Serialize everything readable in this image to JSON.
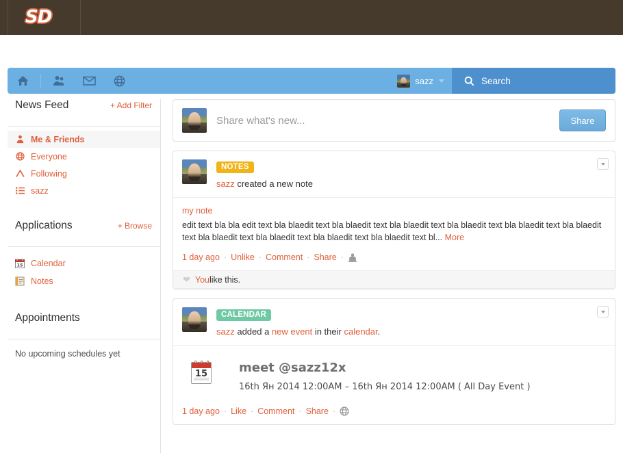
{
  "brand": {
    "logo_text": "SD"
  },
  "nav": {
    "icons": [
      {
        "name": "home-icon",
        "label": "Home"
      },
      {
        "name": "friends-icon",
        "label": "Friends"
      },
      {
        "name": "mail-icon",
        "label": "Messages"
      },
      {
        "name": "globe-icon",
        "label": "Explore"
      }
    ],
    "user": {
      "name": "sazz"
    },
    "search": {
      "placeholder": "Search"
    }
  },
  "sidebar": {
    "news_feed": {
      "title": "News Feed",
      "action": "+ Add Filter",
      "items": [
        {
          "label": "Me & Friends",
          "icon": "person-icon",
          "active": true
        },
        {
          "label": "Everyone",
          "icon": "globe-icon",
          "active": false
        },
        {
          "label": "Following",
          "icon": "following-icon",
          "active": false
        },
        {
          "label": "sazz",
          "icon": "list-icon",
          "active": false
        }
      ]
    },
    "applications": {
      "title": "Applications",
      "action": "+ Browse",
      "items": [
        {
          "label": "Calendar",
          "icon": "calendar-icon"
        },
        {
          "label": "Notes",
          "icon": "notes-icon"
        }
      ]
    },
    "appointments": {
      "title": "Appointments",
      "empty_text": "No upcoming schedules yet"
    }
  },
  "share_box": {
    "placeholder": "Share what's new...",
    "button_label": "Share"
  },
  "posts": [
    {
      "type": "notes",
      "badge": "NOTES",
      "badge_color": "#f0b419",
      "author": "sazz",
      "action_text": " created a new note",
      "note_title": "my note",
      "note_text": "edit text bla bla edit text bla blaedit text bla blaedit text bla blaedit text bla blaedit text bla blaedit text bla blaedit text bla blaedit text bla blaedit text bla blaedit text bla blaedit text bl...",
      "more_label": " More",
      "timestamp": "1 day ago",
      "like_label": "Unlike",
      "comment_label": "Comment",
      "share_label": "Share",
      "privacy_icon": "friends-icon",
      "likebar": {
        "who": "You",
        "text": " like this."
      }
    },
    {
      "type": "calendar",
      "badge": "CALENDAR",
      "badge_color": "#70c9a5",
      "author": "sazz",
      "action_pre": " added a ",
      "action_link": "new event",
      "action_mid": " in their ",
      "action_link2": "calendar",
      "action_post": ".",
      "event": {
        "day_number": "15",
        "title": "meet @sazz12x",
        "when": "16th Ян 2014 12:00AM – 16th Ян 2014 12:00AM ( All Day Event )"
      },
      "timestamp": "1 day ago",
      "like_label": "Like",
      "comment_label": "Comment",
      "share_label": "Share",
      "privacy_icon": "globe-icon"
    }
  ],
  "colors": {
    "brand_brown": "#453a2c",
    "accent_orange": "#e0603c",
    "nav_blue": "#6cafe2",
    "search_blue": "#4e90cd"
  }
}
